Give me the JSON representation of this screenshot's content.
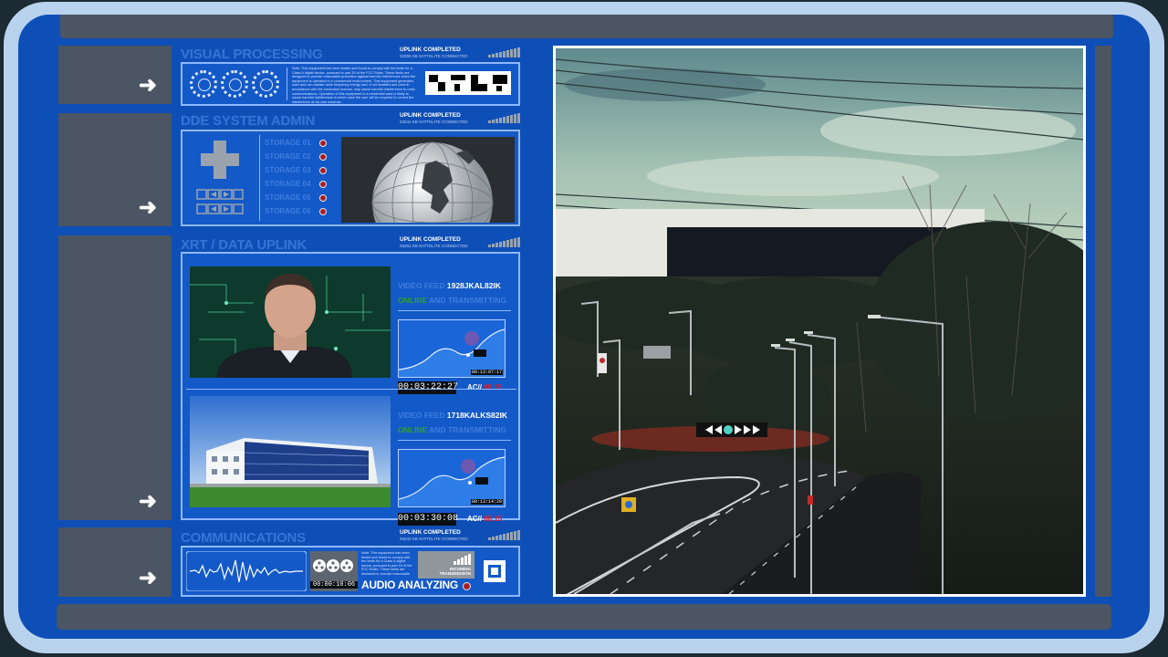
{
  "panels": {
    "visual": {
      "title": "VISUAL PROCESSING",
      "uplink_label": "UPLINK COMPLETED",
      "uplink_sub": "03390 KB SATTELITE CONNECTED",
      "note": "Note: This equipment has been tested and found to comply with the limits for a Class A digital device, pursuant to part 15 of the FCC Rules. These limits are designed to provide reasonable protection against harmful interference when the equipment is operated in a commercial environment. This equipment generates, uses and can radiate radio frequency energy and, if not installed and used in accordance with the instruction manual, may cause harmful interference to radio communications. Operation of this equipment in a residential area is likely to cause harmful interference in which case the user will be required to correct the interference at his own expense."
    },
    "dde": {
      "title": "DDE SYSTEM ADMIN",
      "uplink_label": "UPLINK COMPLETED",
      "uplink_sub": "03241 KB SATTELITE CONNECTED",
      "storage": [
        "STORAGE 01",
        "STORAGE 02",
        "STORAGE 03",
        "STORAGE 04",
        "STORAGE 05",
        "STORAGE 06"
      ]
    },
    "xrt": {
      "title": "XRT / DATA UPLINK",
      "uplink_label": "UPLINK COMPLETED",
      "uplink_sub": "03291 KB SATTELITE CONNECTED",
      "feeds": [
        {
          "label": "VIDEO FEED",
          "id": "1928JKAL82IK",
          "status_green": "ONLINE",
          "status_rest": "AND TRANSMITTING",
          "timecode": "00:03:22:27",
          "graph_tc": "00:13:07:17",
          "ac_label": "AC//",
          "ac_value": "88.15"
        },
        {
          "label": "VIDEO FEED",
          "id": "1718KALKS82IK",
          "status_green": "ONLINE",
          "status_rest": "AND TRANSMITTING",
          "timecode": "00:03:30:08",
          "graph_tc": "00:13:14:29",
          "ac_label": "AC//",
          "ac_value": "88.15"
        }
      ]
    },
    "comms": {
      "title": "COMMUNICATIONS",
      "uplink_label": "UPLINK COMPLETED",
      "uplink_sub": "03242 KB SATTELITE CONNECTED",
      "timecode": "00:00:10:06",
      "audio_label": "AUDIO ANALYZING",
      "incoming_line1": "INCOMING",
      "incoming_line2": "TRANSMISSION",
      "note": "Note: This equipment has been tested and found to comply with the limits for a Class A digital device, pursuant to part 15 of the FCC Rules. These limits are designed to provide reasonable protection against harmful interference."
    }
  },
  "colors": {
    "screen_blue": "#0e4fb7",
    "bezel": "#b9d3ee",
    "title_blue": "#3575d7",
    "status_green": "#2f9e3a",
    "alert_red": "#d8222c"
  },
  "icons": [
    "arrow-right-icon",
    "dpad-icon",
    "globe-icon",
    "film-reel-icon",
    "stop-icon"
  ]
}
